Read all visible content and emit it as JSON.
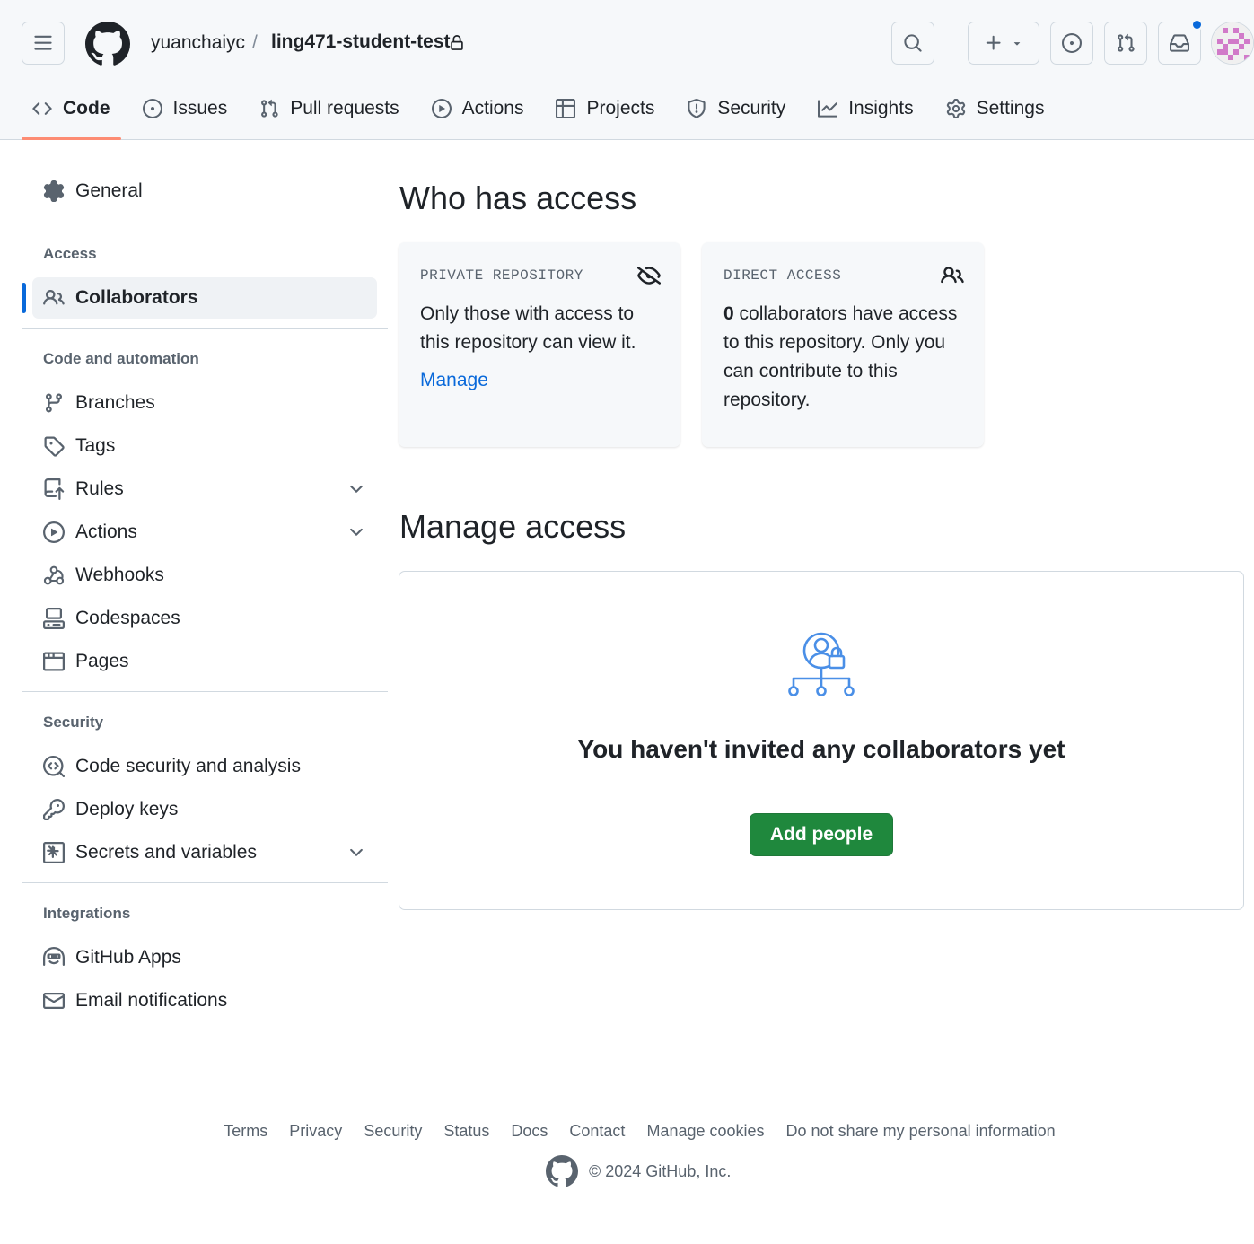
{
  "header": {
    "owner": "yuanchaiyc",
    "separator": "/",
    "repo": "ling471-student-test"
  },
  "tabs": [
    {
      "label": "Code",
      "icon": "code-icon"
    },
    {
      "label": "Issues",
      "icon": "issue-icon"
    },
    {
      "label": "Pull requests",
      "icon": "pull-request-icon"
    },
    {
      "label": "Actions",
      "icon": "play-icon"
    },
    {
      "label": "Projects",
      "icon": "table-icon"
    },
    {
      "label": "Security",
      "icon": "shield-icon"
    },
    {
      "label": "Insights",
      "icon": "graph-icon"
    },
    {
      "label": "Settings",
      "icon": "gear-icon"
    }
  ],
  "sidebar": {
    "general": "General",
    "access_heading": "Access",
    "collaborators": "Collaborators",
    "automation_heading": "Code and automation",
    "branches": "Branches",
    "tags": "Tags",
    "rules": "Rules",
    "actions": "Actions",
    "webhooks": "Webhooks",
    "codespaces": "Codespaces",
    "pages": "Pages",
    "security_heading": "Security",
    "code_security": "Code security and analysis",
    "deploy_keys": "Deploy keys",
    "secrets": "Secrets and variables",
    "integrations_heading": "Integrations",
    "github_apps": "GitHub Apps",
    "email_notifications": "Email notifications"
  },
  "main": {
    "who_title": "Who has access",
    "private_card": {
      "label": "PRIVATE REPOSITORY",
      "text": "Only those with access to this repository can view it.",
      "link": "Manage"
    },
    "direct_card": {
      "label": "DIRECT ACCESS",
      "count": "0",
      "text": " collaborators have access to this repository. Only you can contribute to this repository."
    },
    "manage_title": "Manage access",
    "blank_title": "You haven't invited any collaborators yet",
    "add_button": "Add people"
  },
  "footer": {
    "links": [
      "Terms",
      "Privacy",
      "Security",
      "Status",
      "Docs",
      "Contact",
      "Manage cookies",
      "Do not share my personal information"
    ],
    "copyright": "© 2024 GitHub, Inc."
  },
  "colors": {
    "accent": "#0969da",
    "tab_underline": "#fd8c73",
    "primary_button": "#1f883d",
    "header_bg": "#f6f8fa",
    "notification_dot": "#0969da"
  }
}
